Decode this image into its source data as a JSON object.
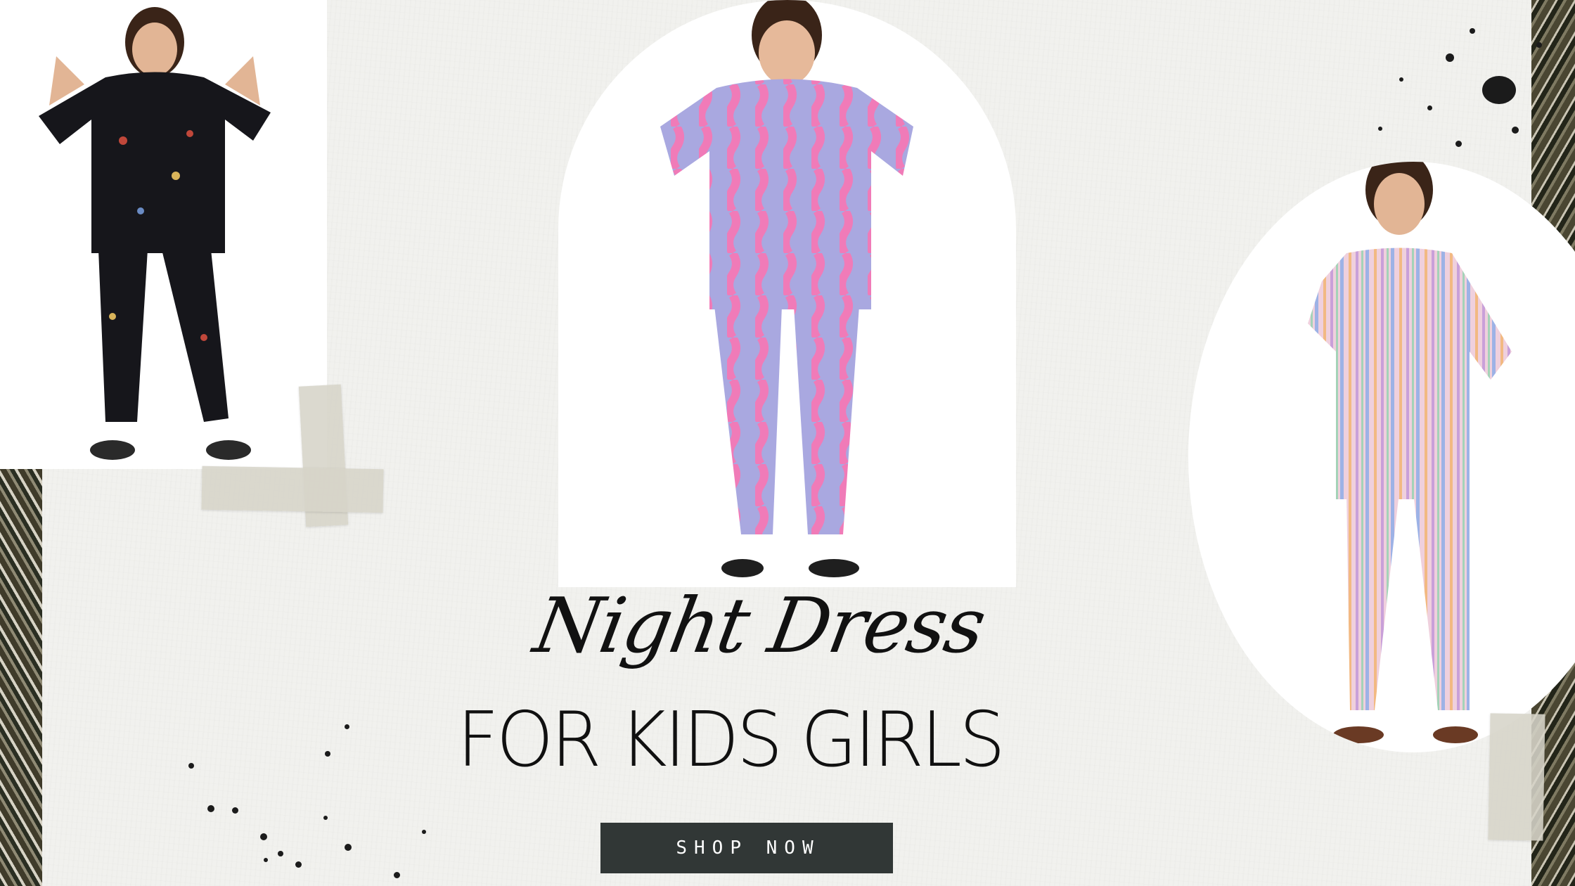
{
  "banner": {
    "script_title": "Night Dress",
    "headline": "FOR KIDS GIRLS",
    "cta_label": "SHOP NOW"
  },
  "photos": [
    {
      "icon": "child-black-pajama-photo",
      "outfit_color": "#15151a"
    },
    {
      "icon": "child-pink-lilac-striped-pajama-photo",
      "outfit_color": "#a9a8e0",
      "stripe_color": "#f07bb8"
    },
    {
      "icon": "child-rainbow-striped-pajama-photo",
      "outfit_color": "#efd0dd",
      "stripe_color": "#9db2e6"
    }
  ],
  "colors": {
    "background": "#f1f1ee",
    "text": "#111111",
    "button": "#313736",
    "button_text": "#ffffff"
  }
}
